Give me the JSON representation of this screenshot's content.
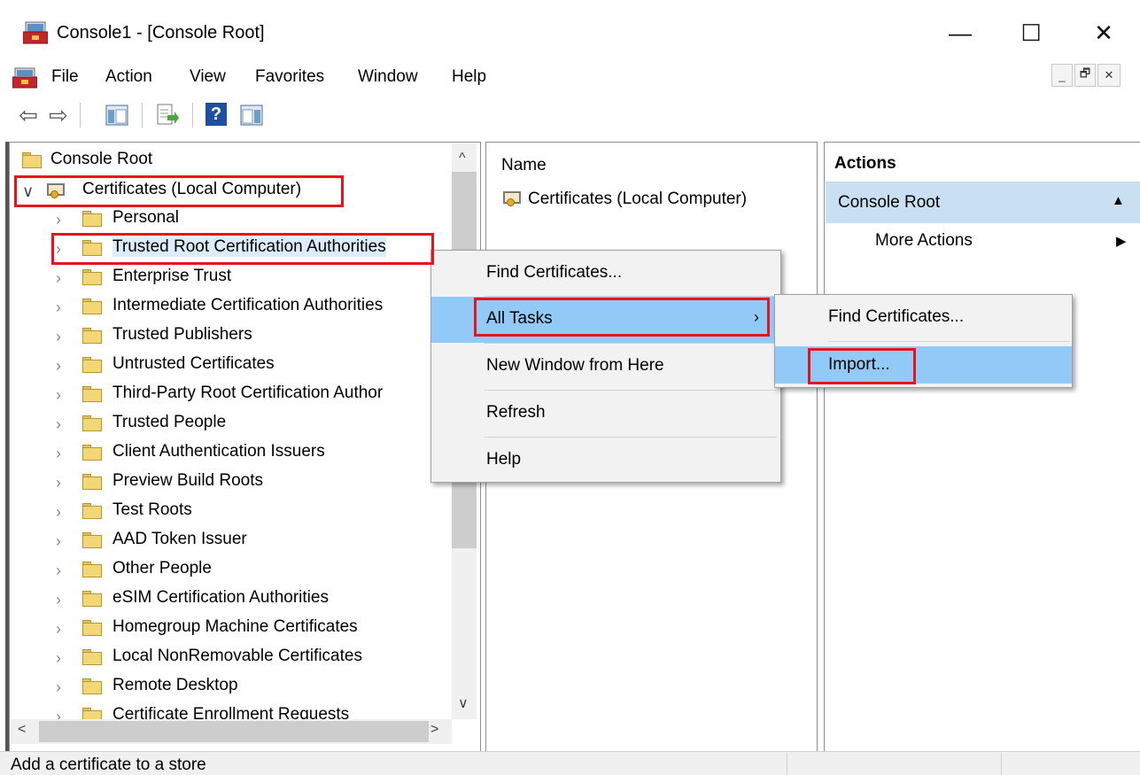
{
  "window": {
    "title": "Console1 - [Console Root]",
    "minimize": "—",
    "maximize": "☐",
    "close": "✕"
  },
  "menubar": {
    "items": [
      "File",
      "Action",
      "View",
      "Favorites",
      "Window",
      "Help"
    ],
    "mdi_minimize": "_",
    "mdi_restore": "🗗",
    "mdi_close": "✕"
  },
  "toolbar": {
    "back": "⇦",
    "forward": "⇨",
    "help": "?"
  },
  "tree": {
    "root": "Console Root",
    "snapin": "Certificates (Local Computer)",
    "stores": [
      "Personal",
      "Trusted Root Certification Authorities",
      "Enterprise Trust",
      "Intermediate Certification Authorities",
      "Trusted Publishers",
      "Untrusted Certificates",
      "Third-Party Root Certification Author",
      "Trusted People",
      "Client Authentication Issuers",
      "Preview Build Roots",
      "Test Roots",
      "AAD Token Issuer",
      "Other People",
      "eSIM Certification Authorities",
      "Homegroup Machine Certificates",
      "Local NonRemovable Certificates",
      "Remote Desktop",
      "Certificate Enrollment Requests"
    ],
    "expanded_chevron": "∨",
    "collapsed_chevron": "›"
  },
  "list": {
    "column_name": "Name",
    "items": [
      "Certificates (Local Computer)"
    ]
  },
  "actions": {
    "header": "Actions",
    "section": "Console Root",
    "collapse_glyph": "▲",
    "more_actions": "More Actions",
    "more_arrow": "▶"
  },
  "context_menu": {
    "items": [
      "Find Certificates...",
      "All Tasks",
      "New Window from Here",
      "Refresh",
      "Help"
    ],
    "submenu_arrow": "›"
  },
  "submenu": {
    "items": [
      "Find Certificates...",
      "Import..."
    ]
  },
  "scroll": {
    "up": "^",
    "down": "∨",
    "left": "<",
    "right": ">"
  },
  "status": {
    "text": "Add a certificate to a store"
  },
  "colors": {
    "highlight": "#91c9f7",
    "annotation_red": "#e8141c",
    "actions_section": "#c9dff2"
  }
}
